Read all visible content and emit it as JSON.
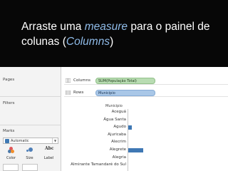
{
  "banner": {
    "line1_prefix": "Arraste uma ",
    "line1_highlight": "measure",
    "line1_suffix": " para o painel de",
    "line2_prefix": "colunas (",
    "line2_highlight": "Columns",
    "line2_suffix": ")"
  },
  "colors": {
    "accent": "#8fbbe8",
    "bar": "#3f78b4",
    "pill_green": "#b8dcb2",
    "pill_blue": "#a9c7e7"
  },
  "left_panel": {
    "pages_title": "Pages",
    "filters_title": "Filters",
    "marks_title": "Marks",
    "mark_type": "Automatic",
    "mark_buttons": [
      "Color",
      "Size",
      "Label"
    ]
  },
  "shelves": {
    "columns": {
      "label": "Columns",
      "pill": "SUM(População Total)",
      "icon": "columns-icon"
    },
    "rows": {
      "label": "Rows",
      "pill": "Municipio",
      "icon": "rows-icon"
    }
  },
  "chart_data": {
    "type": "bar",
    "field_header": "Municipio",
    "categories": [
      "Aceguá",
      "Água Santa",
      "Agudo",
      "Ajuricaba",
      "Alecrim",
      "Alegrete",
      "Alegria",
      "Almirante Tamandaré do Sul"
    ],
    "values": [
      0,
      0,
      3,
      0,
      0,
      14,
      0,
      0
    ]
  }
}
